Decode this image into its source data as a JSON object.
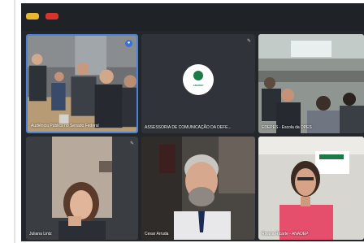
{
  "meeting": {
    "participants": [
      {
        "name": "Audiência Pública no Senado Federal",
        "muted": false,
        "raised_hand": true
      },
      {
        "name": "ASSESSORIA DE COMUNICAÇÃO DA DEFE...",
        "muted": true,
        "logo_text": "ANADEP"
      },
      {
        "name": "EDEPES - Escola da DPES",
        "muted": false
      },
      {
        "name": "Juliana Lintz",
        "muted": true
      },
      {
        "name": "Cesar Arruda",
        "muted": false
      },
      {
        "name": "Rivana Ricarte - ANADEP",
        "muted": false
      }
    ]
  },
  "colors": {
    "background": "#23262b",
    "active_speaker_border": "#4a84d8",
    "window_dot_1": "#e8b630",
    "window_dot_2": "#d9342b"
  },
  "icons": {
    "muted": "mic-off-icon",
    "raised_hand": "raised-hand-icon"
  }
}
